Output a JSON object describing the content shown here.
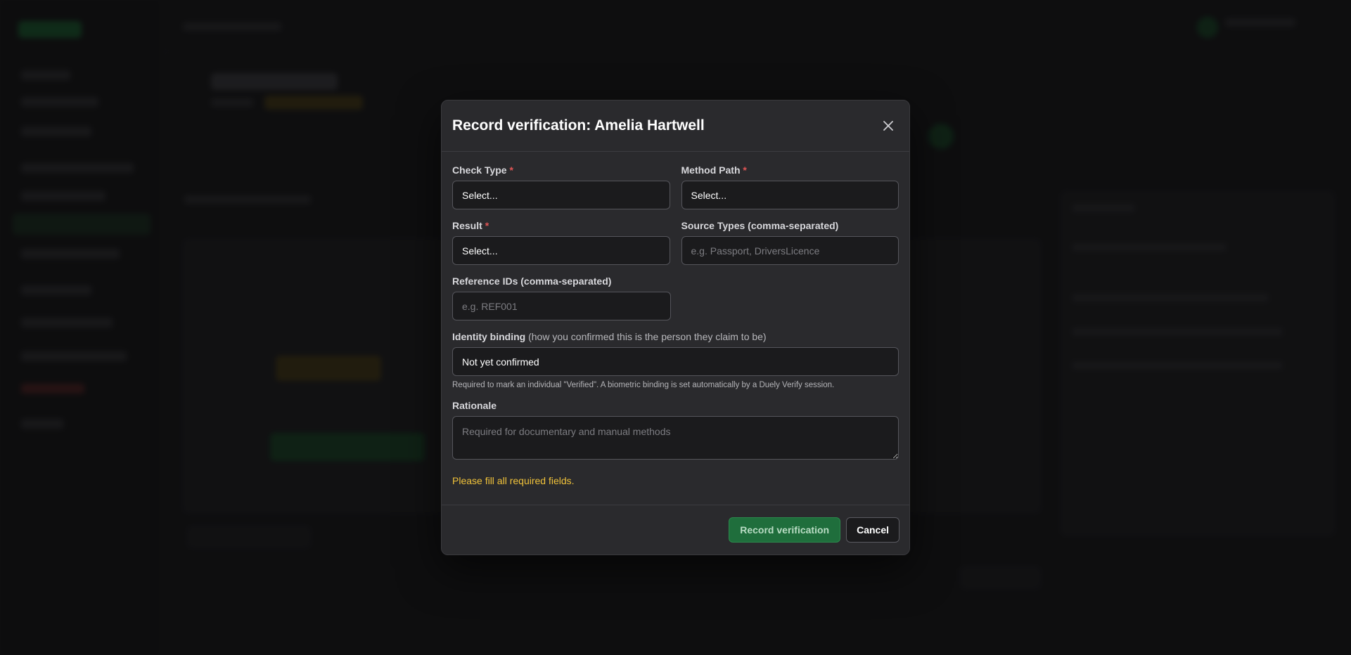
{
  "modal": {
    "title": "Record verification: Amelia Hartwell",
    "close_icon": "close-icon",
    "fields": {
      "check_type": {
        "label": "Check Type",
        "required_mark": "*",
        "value": "Select..."
      },
      "method_path": {
        "label": "Method Path",
        "required_mark": "*",
        "value": "Select..."
      },
      "result": {
        "label": "Result",
        "required_mark": "*",
        "value": "Select..."
      },
      "source_types": {
        "label": "Source Types (comma-separated)",
        "placeholder": "e.g. Passport, DriversLicence"
      },
      "reference_ids": {
        "label": "Reference IDs (comma-separated)",
        "placeholder": "e.g. REF001"
      },
      "identity_binding": {
        "label": "Identity binding",
        "hint": "(how you confirmed this is the person they claim to be)",
        "value": "Not yet confirmed",
        "helper": "Required to mark an individual \"Verified\". A biometric binding is set automatically by a Duely Verify session."
      },
      "rationale": {
        "label": "Rationale",
        "placeholder": "Required for documentary and manual methods"
      }
    },
    "error_message": "Please fill all required fields.",
    "footer": {
      "primary_label": "Record verification",
      "cancel_label": "Cancel"
    }
  },
  "colors": {
    "accent_green": "#1f6e3c",
    "required_red": "#e05555",
    "warning_yellow": "#f0c23a"
  }
}
